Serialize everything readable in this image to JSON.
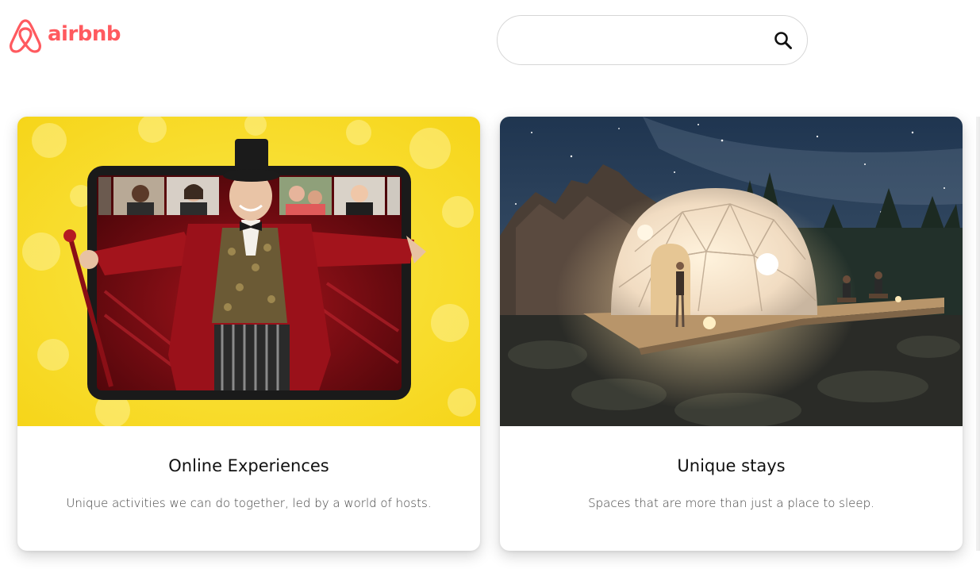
{
  "header": {
    "logo_text": "airbnb",
    "brand_color": "#ff5a5f",
    "search": {
      "value": "",
      "placeholder": "",
      "icon": "search-icon"
    }
  },
  "cards": [
    {
      "title": "Online Experiences",
      "description": "Unique activities we can do together, led by a world of hosts.",
      "image": "ringmaster-on-tablet-video-call"
    },
    {
      "title": "Unique stays",
      "description": "Spaces that are more than just a place to sleep.",
      "image": "glowing-geodesic-dome-at-night"
    }
  ]
}
